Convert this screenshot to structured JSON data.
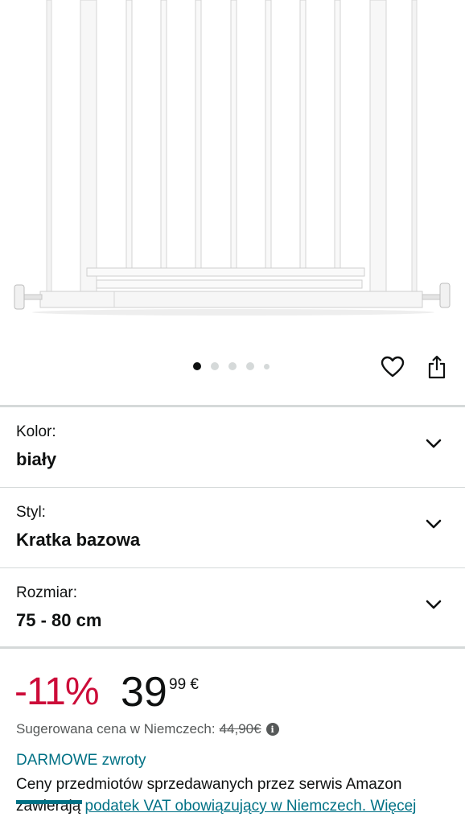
{
  "carousel": {
    "total_images": 5,
    "active_index": 0
  },
  "actions": {
    "wishlist_icon": "heart-icon",
    "share_icon": "share-icon"
  },
  "variants": [
    {
      "label": "Kolor:",
      "value": "biały"
    },
    {
      "label": "Styl:",
      "value": "Kratka bazowa"
    },
    {
      "label": "Rozmiar:",
      "value": "75 - 80 cm"
    }
  ],
  "price": {
    "discount": "-11%",
    "whole": "39",
    "fraction": "99",
    "currency": "€",
    "reference_label": "Sugerowana cena w Niemczech:",
    "reference_price": "44,90€"
  },
  "returns_text": "DARMOWE zwroty",
  "vat_notice": {
    "prefix": "Ceny przedmiotów sprzedawanych przez serwis Amazon zawierają ",
    "link": "podatek VAT obowiązujący w Niemczech. Więcej"
  },
  "colors": {
    "discount": "#cc0c39",
    "link": "#007185",
    "divider": "#d5d9d9"
  }
}
